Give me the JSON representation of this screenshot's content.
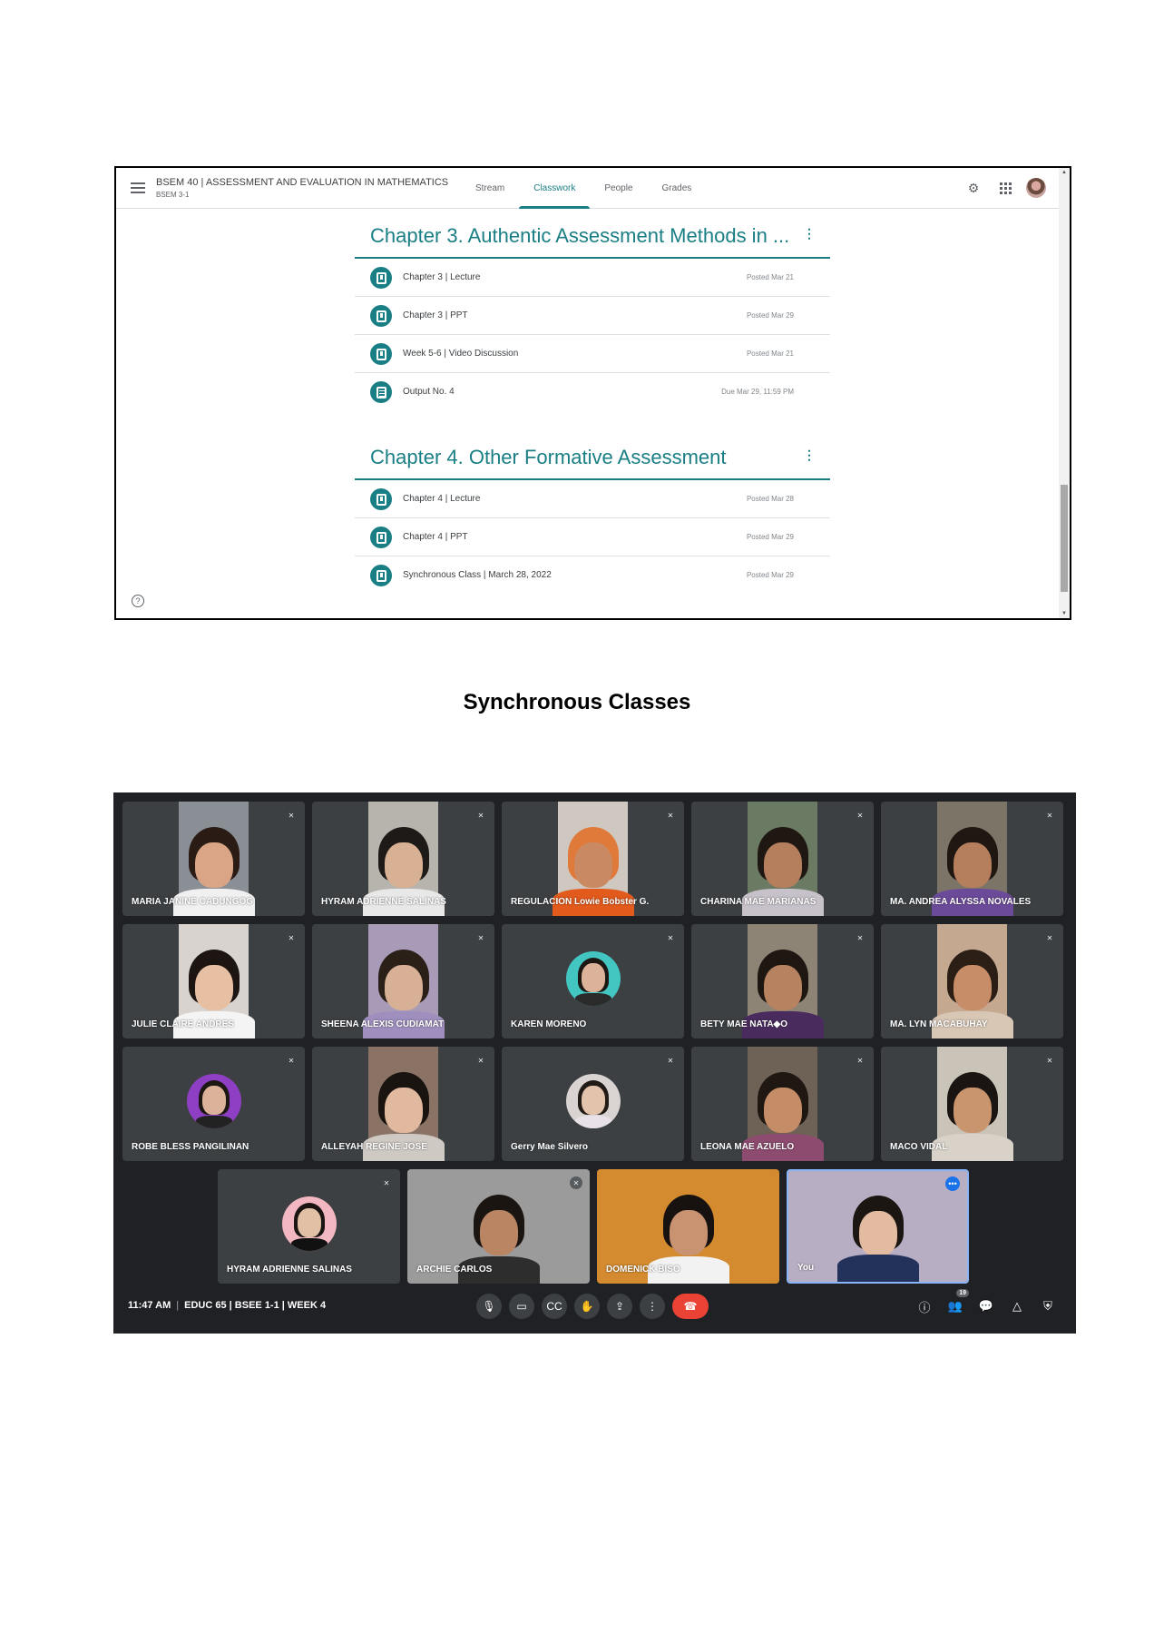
{
  "classroom": {
    "course_title": "BSEM 40 | ASSESSMENT AND EVALUATION IN MATHEMATICS",
    "course_section": "BSEM 3-1",
    "tabs": [
      {
        "label": "Stream",
        "active": false
      },
      {
        "label": "Classwork",
        "active": true
      },
      {
        "label": "People",
        "active": false
      },
      {
        "label": "Grades",
        "active": false
      }
    ],
    "accent_color": "#1a7f85",
    "topics": [
      {
        "title": "Chapter 3. Authentic Assessment Methods in ...",
        "items": [
          {
            "label": "Chapter 3 | Lecture",
            "date": "Posted Mar 21",
            "icon": "material-icon"
          },
          {
            "label": "Chapter 3 | PPT",
            "date": "Posted Mar 29",
            "icon": "material-icon"
          },
          {
            "label": "Week 5-6 | Video Discussion",
            "date": "Posted Mar 21",
            "icon": "material-icon"
          },
          {
            "label": "Output No. 4",
            "date": "Due Mar 29, 11:59 PM",
            "icon": "assignment-icon"
          }
        ]
      },
      {
        "title": "Chapter 4. Other Formative Assessment",
        "items": [
          {
            "label": "Chapter 4 | Lecture",
            "date": "Posted Mar 28",
            "icon": "material-icon"
          },
          {
            "label": "Chapter 4 | PPT",
            "date": "Posted Mar 29",
            "icon": "material-icon"
          },
          {
            "label": "Synchronous Class | March 28, 2022",
            "date": "Posted Mar 29",
            "icon": "material-icon"
          }
        ]
      }
    ]
  },
  "caption": "Synchronous Classes",
  "meet": {
    "participants": [
      {
        "name": "MARIA JANINE CADUNGOG",
        "bg": "#8a8f96",
        "skin": "#d9a586",
        "hair": "#2a1c14",
        "shirt": "#f0f0f0"
      },
      {
        "name": "HYRAM ADRIENNE SALINAS",
        "bg": "#b7b3ad",
        "skin": "#d8b093",
        "hair": "#1e1a17",
        "shirt": "#e8e8e8"
      },
      {
        "name": "REGULACION Lowie Bobster G.",
        "bg": "#cfc8c0",
        "skin": "#c98a63",
        "hair": "#e07a3a",
        "shirt": "#e25a1c"
      },
      {
        "name": "CHARINA MAE MARIANAS",
        "bg": "#6a7a63",
        "skin": "#b57f5e",
        "hair": "#1f1712",
        "shirt": "#c7c1c9"
      },
      {
        "name": "MA. ANDREA ALYSSA NOVALES",
        "bg": "#7d7468",
        "skin": "#b57f5e",
        "hair": "#1f1712",
        "shirt": "#6c4a9a"
      },
      {
        "name": "JULIE CLAIRE ANDRES",
        "bg": "#d8d3cf",
        "skin": "#e7c0a4",
        "hair": "#1c1511",
        "shirt": "#f4f4f4"
      },
      {
        "name": "SHEENA ALEXIS CUDIAMAT",
        "bg": "#a79bb8",
        "skin": "#d8b096",
        "hair": "#2b2018",
        "shirt": "#9f8fbf"
      },
      {
        "name": "KAREN MORENO",
        "bg": "#3c4043",
        "skin": "#dcb39a",
        "hair": "#1d1714",
        "shirt": "#2a2a2a",
        "avatar": "#43c6c2"
      },
      {
        "name": "BETY MAE NATA◆O",
        "bg": "#8d8476",
        "skin": "#b6825f",
        "hair": "#1d1611",
        "shirt": "#4a2b5e"
      },
      {
        "name": "MA. LYN MACABUHAY",
        "bg": "#c4a88f",
        "skin": "#c68d68",
        "hair": "#2a1e15",
        "shirt": "#d9c7b5"
      },
      {
        "name": "ROBE BLESS PANGILINAN",
        "bg": "#3c4043",
        "skin": "#dcb39a",
        "hair": "#1d1714",
        "shirt": "#222222",
        "avatar": "#8e3fc4"
      },
      {
        "name": "ALLEYAH REGINE JOSE",
        "bg": "#8a7365",
        "skin": "#e0b99e",
        "hair": "#1a1411",
        "shirt": "#cfc9c4"
      },
      {
        "name": "Gerry Mae Silvero",
        "bg": "#3c4043",
        "skin": "#e4c3ad",
        "hair": "#221a15",
        "shirt": "#e8e2e8",
        "avatar": "#d9d4d2"
      },
      {
        "name": "LEONA MAE AZUELO",
        "bg": "#6e6256",
        "skin": "#c58c68",
        "hair": "#1f1712",
        "shirt": "#8d4b6f"
      },
      {
        "name": "MACO VIDAL",
        "bg": "#c9c3b8",
        "skin": "#c9956f",
        "hair": "#1a1512",
        "shirt": "#d9d2c8"
      },
      {
        "name": "HYRAM ADRIENNE SALINAS",
        "bg": "#3c4043",
        "skin": "#e1c0a5",
        "hair": "#1a1512",
        "shirt": "#111111",
        "avatar": "#f3b7c2"
      },
      {
        "name": "ARCHIE CARLOS",
        "bg": "#9b9b9b",
        "skin": "#b98563",
        "hair": "#1b1511",
        "shirt": "#2d2d2d"
      },
      {
        "name": "DOMENICK BISO",
        "bg": "#d48a2e",
        "skin": "#c99372",
        "hair": "#17120f",
        "shirt": "#f2f2f2"
      },
      {
        "name": "You",
        "bg": "#b8aec4",
        "skin": "#e2bba0",
        "hair": "#1c1612",
        "shirt": "#22325a"
      }
    ],
    "time": "11:47 AM",
    "meeting_title": "EDUC 65 | BSEE 1-1 | WEEK 4",
    "participant_count": "19",
    "end_call_color": "#ea4335"
  }
}
